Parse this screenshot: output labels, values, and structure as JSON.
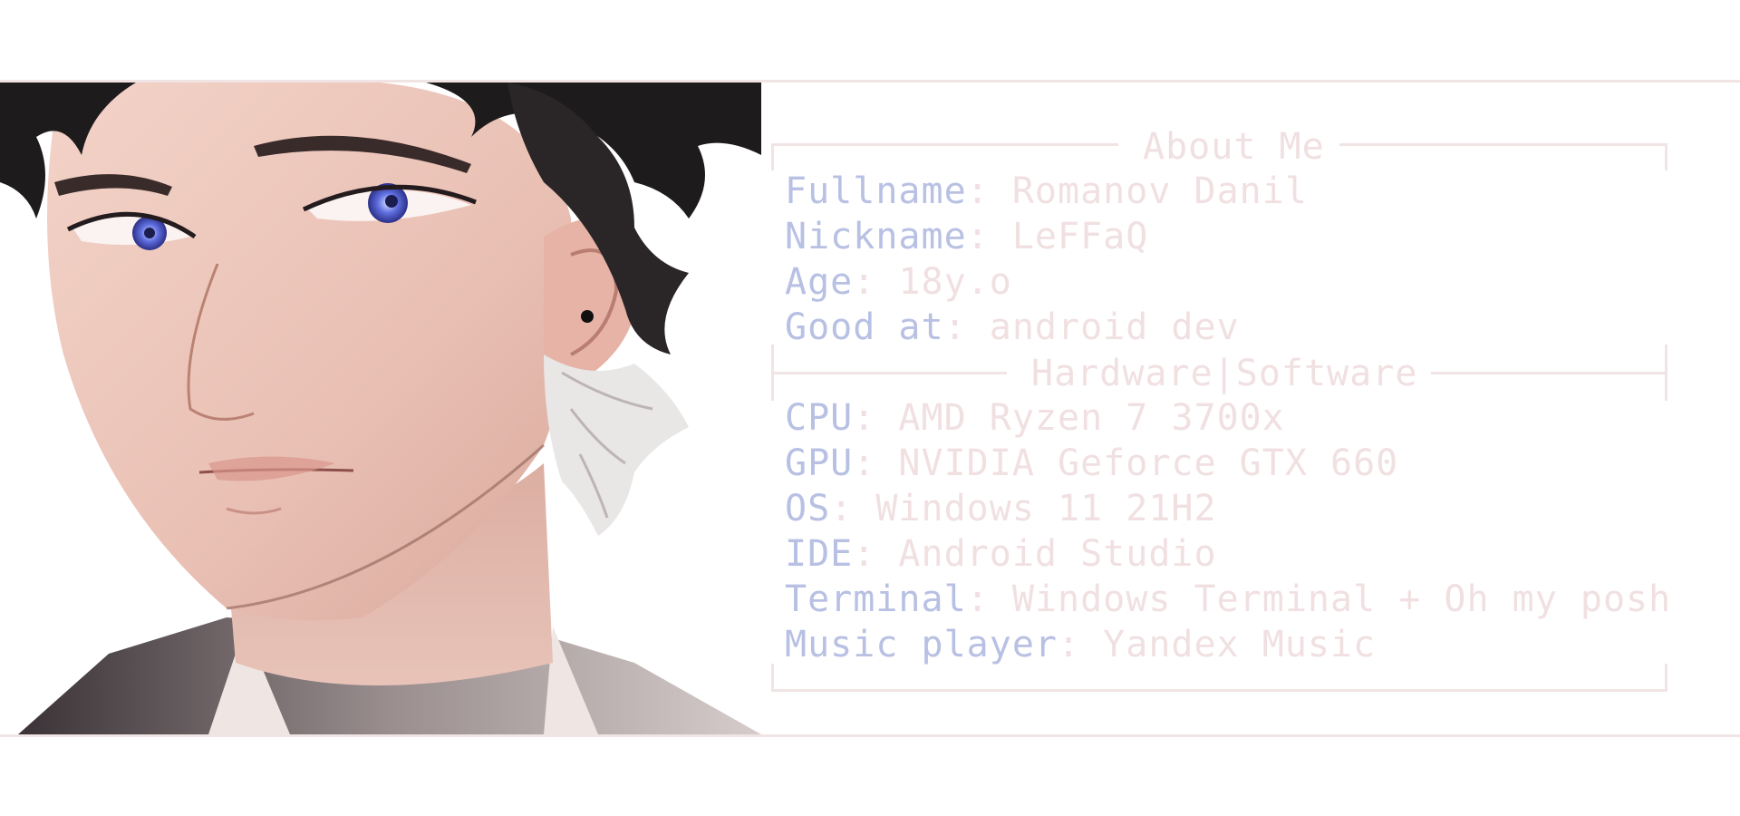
{
  "colors": {
    "background": "#ffffff",
    "rule": "#f1e4e4",
    "key": "#b8c0e3",
    "value": "#f1e0e1"
  },
  "portrait": {
    "icon": "anime-portrait-illustration"
  },
  "sections": [
    {
      "title": "About Me",
      "items": [
        {
          "key": "Fullname",
          "value": "Romanov Danil"
        },
        {
          "key": "Nickname",
          "value": "LeFFaQ"
        },
        {
          "key": "Age",
          "value": "18y.o"
        },
        {
          "key": "Good at",
          "value": "android dev"
        }
      ]
    },
    {
      "title": "Hardware|Software",
      "items": [
        {
          "key": "CPU",
          "value": "AMD Ryzen 7 3700x"
        },
        {
          "key": "GPU",
          "value": "NVIDIA Geforce GTX 660"
        },
        {
          "key": "OS",
          "value": "Windows 11 21H2"
        },
        {
          "key": "IDE",
          "value": "Android Studio"
        },
        {
          "key": "Terminal",
          "value": "Windows Terminal + Oh my posh"
        },
        {
          "key": "Music player",
          "value": "Yandex Music"
        }
      ]
    }
  ],
  "separator": ": "
}
